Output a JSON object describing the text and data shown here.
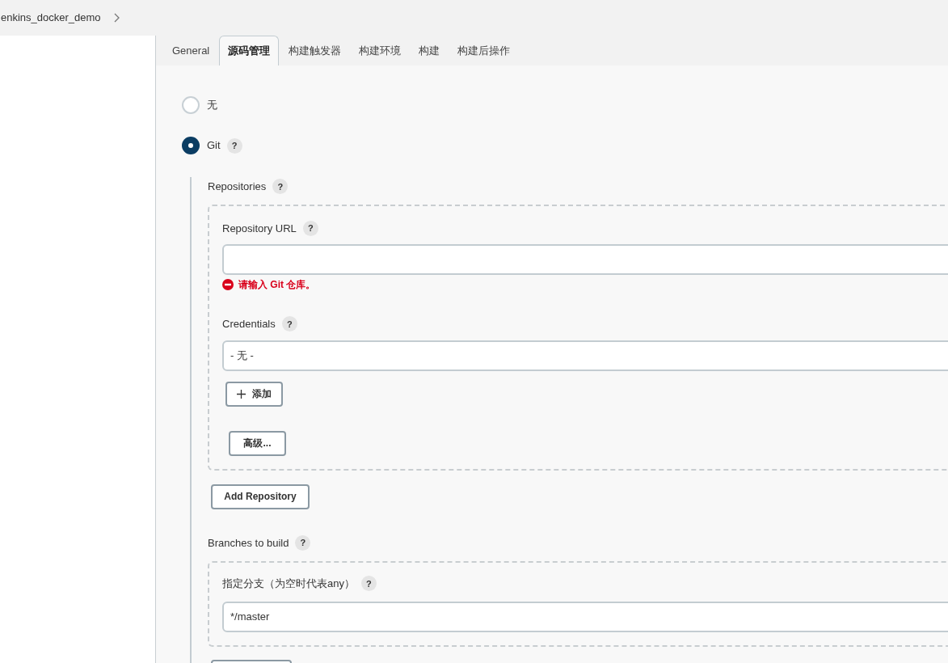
{
  "breadcrumb": {
    "item": "enkins_docker_demo"
  },
  "tabs": [
    {
      "label": "General",
      "selected": false
    },
    {
      "label": "源码管理",
      "selected": true
    },
    {
      "label": "构建触发器",
      "selected": false
    },
    {
      "label": "构建环境",
      "selected": false
    },
    {
      "label": "构建",
      "selected": false
    },
    {
      "label": "构建后操作",
      "selected": false
    }
  ],
  "scm_options": [
    {
      "label": "无",
      "selected": false
    },
    {
      "label": "Git",
      "selected": true,
      "help": "?"
    }
  ],
  "git": {
    "repositories": {
      "label": "Repositories",
      "help": "?",
      "url": {
        "label": "Repository URL",
        "help": "?",
        "error": "请输入 Git 仓库。"
      },
      "credentials": {
        "label": "Credentials",
        "help": "?",
        "value": "- 无 -",
        "add_button": "添加"
      },
      "advanced_button": "高级...",
      "add_button": "Add Repository"
    },
    "branches": {
      "label": "Branches to build",
      "help": "?",
      "branch_label": "指定分支（为空时代表any）",
      "branch_help": "?",
      "branch_value": "*/master"
    }
  }
}
